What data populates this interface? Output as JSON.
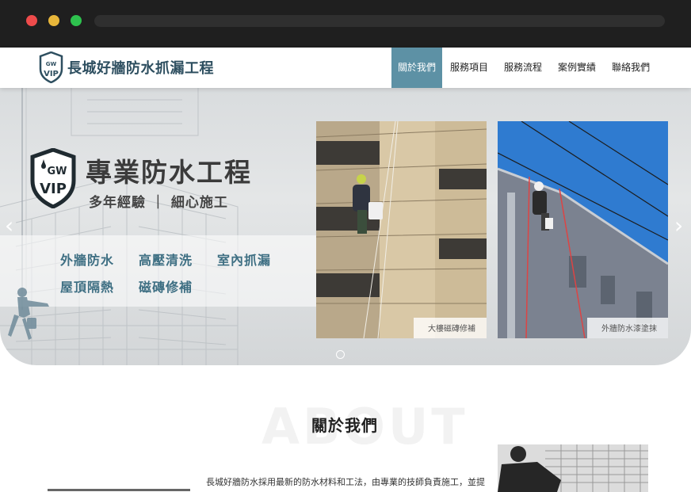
{
  "browser": {
    "dots": [
      "#ee4b4b",
      "#e8b63a",
      "#2ec24e"
    ]
  },
  "header": {
    "logo_text_top": "GW",
    "logo_text_bottom": "VIP",
    "brand": "長城好牆防水抓漏工程",
    "nav": [
      {
        "label": "關於我們",
        "active": true
      },
      {
        "label": "服務項目",
        "active": false
      },
      {
        "label": "服務流程",
        "active": false
      },
      {
        "label": "案例實績",
        "active": false
      },
      {
        "label": "聯絡我們",
        "active": false
      }
    ],
    "accent": "#5d91a5"
  },
  "hero": {
    "title": "專業防水工程",
    "subtitle": "多年經驗 ｜ 細心施工",
    "services": [
      "外牆防水",
      "高壓清洗",
      "室內抓漏",
      "屋頂隔熱",
      "磁磚修補"
    ],
    "photos": [
      {
        "caption": "大樓磁磚修補"
      },
      {
        "caption": "外牆防水漆塗抹"
      }
    ],
    "prev_arrow": "‹",
    "next_arrow": "›"
  },
  "about": {
    "watermark": "ABOUT",
    "title": "關於我們",
    "text": "長城好牆防水採用最新的防水材料和工法，由專業的技師負責施工，並提"
  }
}
